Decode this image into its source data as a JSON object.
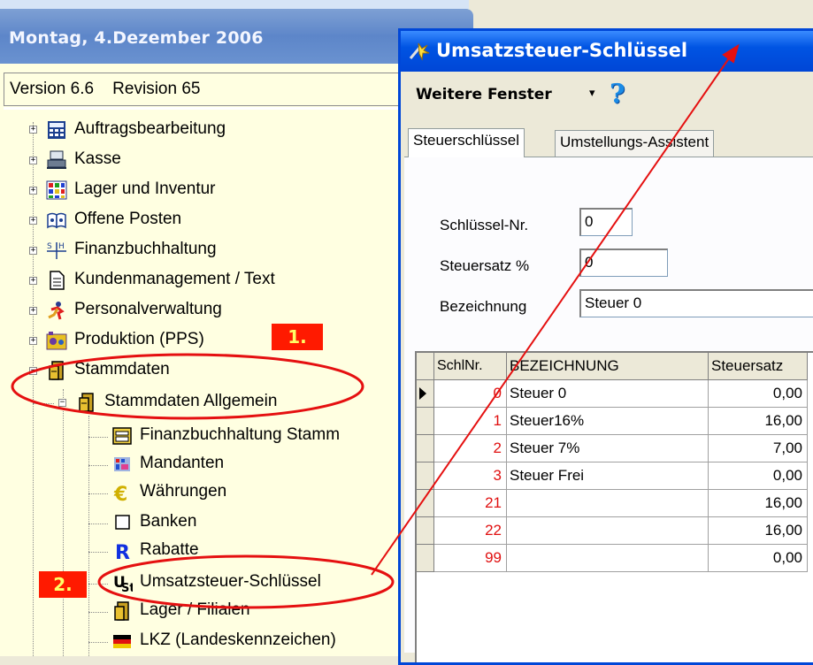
{
  "nav": {
    "date": "Montag, 4.Dezember 2006",
    "version": "Version 6.6    Revision 65",
    "items": [
      {
        "label": "Auftragsbearbeitung",
        "icon": "calculator-icon"
      },
      {
        "label": "Kasse",
        "icon": "cash-register-icon"
      },
      {
        "label": "Lager und Inventur",
        "icon": "warehouse-grid-icon"
      },
      {
        "label": "Offene Posten",
        "icon": "open-book-icon"
      },
      {
        "label": "Finanzbuchhaltung",
        "icon": "ledger-icon"
      },
      {
        "label": "Kundenmanagement / Text",
        "icon": "document-icon"
      },
      {
        "label": "Personalverwaltung",
        "icon": "person-running-icon"
      },
      {
        "label": "Produktion (PPS)",
        "icon": "factory-icon"
      },
      {
        "label": "Stammdaten",
        "icon": "cabinet-icon"
      }
    ],
    "stammdaten_child": {
      "label": "Stammdaten Allgemein",
      "icon": "cabinet-icon"
    },
    "subitems": [
      {
        "label": "Finanzbuchhaltung Stamm",
        "icon": "cash-box-icon"
      },
      {
        "label": "Mandanten",
        "icon": "mandanten-icon"
      },
      {
        "label": "Währungen",
        "icon": "euro-icon"
      },
      {
        "label": "Banken",
        "icon": "square-outline-icon"
      },
      {
        "label": "Rabatte",
        "icon": "letter-r-icon"
      },
      {
        "label": "Umsatzsteuer-Schlüssel",
        "icon": "tax-icon"
      },
      {
        "label": "Lager / Filialen",
        "icon": "cabinet-icon"
      },
      {
        "label": "LKZ (Landeskennzeichen)",
        "icon": "flag-germany-icon"
      }
    ]
  },
  "annotations": {
    "badge1": "1.",
    "badge2": "2."
  },
  "dialog": {
    "title": "Umsatzsteuer-Schlüssel",
    "menu_label": "Weitere Fenster",
    "menu_arrow": "▾",
    "help": "?",
    "tabs": [
      "Steuerschlüssel",
      "Umstellungs-Assistent"
    ],
    "fields": {
      "key_label": "Schlüssel-Nr.",
      "key_value": "0",
      "rate_label": "Steuersatz %",
      "rate_value": "0",
      "name_label": "Bezeichnung",
      "name_value": "Steuer 0"
    },
    "grid": {
      "columns": [
        "SchlNr.",
        "BEZEICHNUNG",
        "Steuersatz"
      ],
      "rows": [
        [
          "0",
          "Steuer 0",
          "0,00"
        ],
        [
          "1",
          "Steuer16%",
          "16,00"
        ],
        [
          "2",
          "Steuer 7%",
          "7,00"
        ],
        [
          "3",
          "Steuer Frei",
          "0,00"
        ],
        [
          "21",
          "",
          "16,00"
        ],
        [
          "22",
          "",
          "16,00"
        ],
        [
          "99",
          "",
          "0,00"
        ]
      ]
    }
  },
  "colors": {
    "title_blue": "#0054e3",
    "badge_red": "#ff1a00",
    "ellipse_red": "#e51010",
    "tree_bg": "#ffffe1"
  }
}
